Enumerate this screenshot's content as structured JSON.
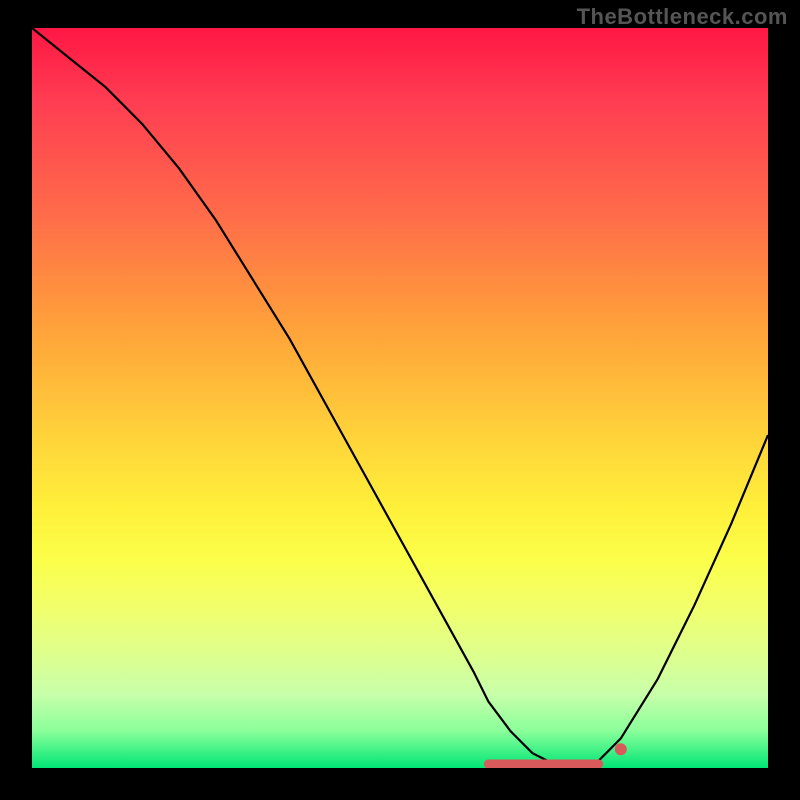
{
  "watermark": "TheBottleneck.com",
  "chart_data": {
    "type": "line",
    "title": "",
    "xlabel": "",
    "ylabel": "",
    "xlim": [
      0,
      100
    ],
    "ylim": [
      0,
      100
    ],
    "series": [
      {
        "name": "curve",
        "x": [
          0,
          5,
          10,
          15,
          20,
          25,
          30,
          35,
          40,
          45,
          50,
          55,
          60,
          62,
          65,
          68,
          70,
          72,
          74,
          76,
          80,
          85,
          90,
          95,
          100
        ],
        "y": [
          100,
          96,
          92,
          87,
          81,
          74,
          66,
          58,
          49,
          40,
          31,
          22,
          13,
          9,
          5,
          2,
          1,
          0,
          0,
          0,
          4,
          12,
          22,
          33,
          45
        ]
      }
    ],
    "markers": {
      "flat_segment": {
        "x_start": 62,
        "x_end": 77,
        "y": 0
      },
      "dot": {
        "x": 80,
        "y": 2
      }
    },
    "gradient": {
      "orientation": "vertical",
      "stops": [
        {
          "pos": 0.0,
          "color": "#ff1744"
        },
        {
          "pos": 0.25,
          "color": "#ff6b4a"
        },
        {
          "pos": 0.55,
          "color": "#ffd23a"
        },
        {
          "pos": 0.78,
          "color": "#f2ff6a"
        },
        {
          "pos": 0.95,
          "color": "#8aff9a"
        },
        {
          "pos": 1.0,
          "color": "#00e676"
        }
      ]
    }
  }
}
